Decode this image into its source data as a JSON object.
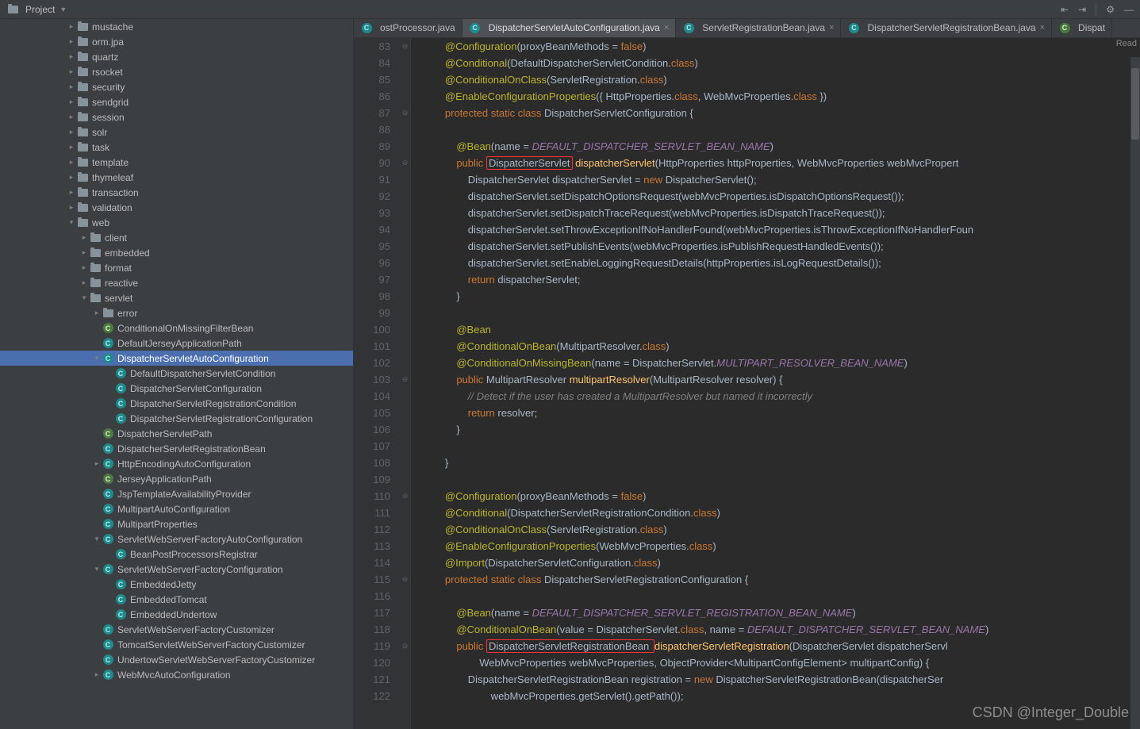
{
  "toolbar": {
    "project_label": "Project"
  },
  "read_indicator": "Read",
  "watermark": "CSDN @Integer_Double",
  "tabs": [
    {
      "label": "ostProcessor.java",
      "icon": "class-cyan",
      "active": false,
      "truncated": true
    },
    {
      "label": "DispatcherServletAutoConfiguration.java",
      "icon": "class-cyan",
      "active": true
    },
    {
      "label": "ServletRegistrationBean.java",
      "icon": "class-cyan",
      "active": false
    },
    {
      "label": "DispatcherServletRegistrationBean.java",
      "icon": "class-cyan",
      "active": false
    },
    {
      "label": "Dispat",
      "icon": "class-green",
      "active": false,
      "truncated": true
    }
  ],
  "tree": [
    {
      "indent": 5,
      "chev": ">",
      "icon": "folder",
      "label": "mustache"
    },
    {
      "indent": 5,
      "chev": ">",
      "icon": "folder",
      "label": "orm.jpa"
    },
    {
      "indent": 5,
      "chev": ">",
      "icon": "folder",
      "label": "quartz"
    },
    {
      "indent": 5,
      "chev": ">",
      "icon": "folder",
      "label": "rsocket"
    },
    {
      "indent": 5,
      "chev": ">",
      "icon": "folder",
      "label": "security"
    },
    {
      "indent": 5,
      "chev": ">",
      "icon": "folder",
      "label": "sendgrid"
    },
    {
      "indent": 5,
      "chev": ">",
      "icon": "folder",
      "label": "session"
    },
    {
      "indent": 5,
      "chev": ">",
      "icon": "folder",
      "label": "solr"
    },
    {
      "indent": 5,
      "chev": ">",
      "icon": "folder",
      "label": "task"
    },
    {
      "indent": 5,
      "chev": ">",
      "icon": "folder",
      "label": "template"
    },
    {
      "indent": 5,
      "chev": ">",
      "icon": "folder",
      "label": "thymeleaf"
    },
    {
      "indent": 5,
      "chev": ">",
      "icon": "folder",
      "label": "transaction"
    },
    {
      "indent": 5,
      "chev": ">",
      "icon": "folder",
      "label": "validation"
    },
    {
      "indent": 5,
      "chev": "v",
      "icon": "folder",
      "label": "web"
    },
    {
      "indent": 6,
      "chev": ">",
      "icon": "folder",
      "label": "client"
    },
    {
      "indent": 6,
      "chev": ">",
      "icon": "folder",
      "label": "embedded"
    },
    {
      "indent": 6,
      "chev": ">",
      "icon": "folder",
      "label": "format"
    },
    {
      "indent": 6,
      "chev": ">",
      "icon": "folder",
      "label": "reactive"
    },
    {
      "indent": 6,
      "chev": "v",
      "icon": "folder",
      "label": "servlet"
    },
    {
      "indent": 7,
      "chev": ">",
      "icon": "folder",
      "label": "error"
    },
    {
      "indent": 7,
      "chev": "",
      "icon": "class-green",
      "label": "ConditionalOnMissingFilterBean"
    },
    {
      "indent": 7,
      "chev": "",
      "icon": "class-cyan",
      "label": "DefaultJerseyApplicationPath"
    },
    {
      "indent": 7,
      "chev": "v",
      "icon": "class-cyan",
      "label": "DispatcherServletAutoConfiguration",
      "selected": true
    },
    {
      "indent": 8,
      "chev": "",
      "icon": "class-cyan",
      "label": "DefaultDispatcherServletCondition"
    },
    {
      "indent": 8,
      "chev": "",
      "icon": "class-cyan",
      "label": "DispatcherServletConfiguration"
    },
    {
      "indent": 8,
      "chev": "",
      "icon": "class-cyan",
      "label": "DispatcherServletRegistrationCondition"
    },
    {
      "indent": 8,
      "chev": "",
      "icon": "class-cyan",
      "label": "DispatcherServletRegistrationConfiguration"
    },
    {
      "indent": 7,
      "chev": "",
      "icon": "class-green",
      "label": "DispatcherServletPath"
    },
    {
      "indent": 7,
      "chev": "",
      "icon": "class-cyan",
      "label": "DispatcherServletRegistrationBean"
    },
    {
      "indent": 7,
      "chev": ">",
      "icon": "class-cyan",
      "label": "HttpEncodingAutoConfiguration"
    },
    {
      "indent": 7,
      "chev": "",
      "icon": "class-green",
      "label": "JerseyApplicationPath"
    },
    {
      "indent": 7,
      "chev": "",
      "icon": "class-cyan",
      "label": "JspTemplateAvailabilityProvider"
    },
    {
      "indent": 7,
      "chev": "",
      "icon": "class-cyan",
      "label": "MultipartAutoConfiguration"
    },
    {
      "indent": 7,
      "chev": "",
      "icon": "class-cyan",
      "label": "MultipartProperties"
    },
    {
      "indent": 7,
      "chev": "v",
      "icon": "class-cyan",
      "label": "ServletWebServerFactoryAutoConfiguration"
    },
    {
      "indent": 8,
      "chev": "",
      "icon": "class-cyan",
      "label": "BeanPostProcessorsRegistrar"
    },
    {
      "indent": 7,
      "chev": "v",
      "icon": "class-cyan",
      "label": "ServletWebServerFactoryConfiguration"
    },
    {
      "indent": 8,
      "chev": "",
      "icon": "class-cyan",
      "label": "EmbeddedJetty"
    },
    {
      "indent": 8,
      "chev": "",
      "icon": "class-cyan",
      "label": "EmbeddedTomcat"
    },
    {
      "indent": 8,
      "chev": "",
      "icon": "class-cyan",
      "label": "EmbeddedUndertow"
    },
    {
      "indent": 7,
      "chev": "",
      "icon": "class-cyan",
      "label": "ServletWebServerFactoryCustomizer"
    },
    {
      "indent": 7,
      "chev": "",
      "icon": "class-cyan",
      "label": "TomcatServletWebServerFactoryCustomizer"
    },
    {
      "indent": 7,
      "chev": "",
      "icon": "class-cyan",
      "label": "UndertowServletWebServerFactoryCustomizer"
    },
    {
      "indent": 7,
      "chev": ">",
      "icon": "class-cyan",
      "label": "WebMvcAutoConfiguration"
    }
  ],
  "code": {
    "first_line": 83,
    "lines": [
      {
        "n": 83,
        "h": "        <span class='an'>@Configuration</span>(proxyBeanMethods = <span class='k'>false</span>)"
      },
      {
        "n": 84,
        "h": "        <span class='an'>@Conditional</span>(DefaultDispatcherServletCondition.<span class='k'>class</span>)"
      },
      {
        "n": 85,
        "h": "        <span class='an'>@ConditionalOnClass</span>(ServletRegistration.<span class='k'>class</span>)"
      },
      {
        "n": 86,
        "h": "        <span class='an'>@EnableConfigurationProperties</span>({ HttpProperties.<span class='k'>class</span>, WebMvcProperties.<span class='k'>class</span> })"
      },
      {
        "n": 87,
        "h": "        <span class='k'>protected</span> <span class='k'>static</span> <span class='k'>class</span> DispatcherServletConfiguration {"
      },
      {
        "n": 88,
        "h": ""
      },
      {
        "n": 89,
        "h": "            <span class='an'>@Bean</span>(name = <span class='fld'>DEFAULT_DISPATCHER_SERVLET_BEAN_NAME</span>)"
      },
      {
        "n": 90,
        "h": "            <span class='k'>public</span> <span class='box-red'>DispatcherServlet</span> <span class='fn'>dispatcherServlet</span>(HttpProperties httpProperties, WebMvcProperties webMvcPropert"
      },
      {
        "n": 91,
        "h": "                DispatcherServlet dispatcherServlet = <span class='k'>new</span> DispatcherServlet();"
      },
      {
        "n": 92,
        "h": "                dispatcherServlet.setDispatchOptionsRequest(webMvcProperties.isDispatchOptionsRequest());"
      },
      {
        "n": 93,
        "h": "                dispatcherServlet.setDispatchTraceRequest(webMvcProperties.isDispatchTraceRequest());"
      },
      {
        "n": 94,
        "h": "                dispatcherServlet.setThrowExceptionIfNoHandlerFound(webMvcProperties.isThrowExceptionIfNoHandlerFoun"
      },
      {
        "n": 95,
        "h": "                dispatcherServlet.setPublishEvents(webMvcProperties.isPublishRequestHandledEvents());"
      },
      {
        "n": 96,
        "h": "                dispatcherServlet.setEnableLoggingRequestDetails(httpProperties.isLogRequestDetails());"
      },
      {
        "n": 97,
        "h": "                <span class='k'>return</span> dispatcherServlet;"
      },
      {
        "n": 98,
        "h": "            }"
      },
      {
        "n": 99,
        "h": ""
      },
      {
        "n": 100,
        "h": "            <span class='an'>@Bean</span>"
      },
      {
        "n": 101,
        "h": "            <span class='an'>@ConditionalOnBean</span>(MultipartResolver.<span class='k'>class</span>)"
      },
      {
        "n": 102,
        "h": "            <span class='an'>@ConditionalOnMissingBean</span>(name = DispatcherServlet.<span class='fld'>MULTIPART_RESOLVER_BEAN_NAME</span>)"
      },
      {
        "n": 103,
        "h": "            <span class='k'>public</span> MultipartResolver <span class='fn'>multipartResolver</span>(MultipartResolver resolver) {"
      },
      {
        "n": 104,
        "h": "                <span class='cmt'>// Detect if the user has created a MultipartResolver but named it incorrectly</span>"
      },
      {
        "n": 105,
        "h": "                <span class='k'>return</span> resolver;"
      },
      {
        "n": 106,
        "h": "            }"
      },
      {
        "n": 107,
        "h": ""
      },
      {
        "n": 108,
        "h": "        }"
      },
      {
        "n": 109,
        "h": ""
      },
      {
        "n": 110,
        "h": "        <span class='an'>@Configuration</span>(proxyBeanMethods = <span class='k'>false</span>)"
      },
      {
        "n": 111,
        "h": "        <span class='an'>@Conditional</span>(DispatcherServletRegistrationCondition.<span class='k'>class</span>)"
      },
      {
        "n": 112,
        "h": "        <span class='an'>@ConditionalOnClass</span>(ServletRegistration.<span class='k'>class</span>)"
      },
      {
        "n": 113,
        "h": "        <span class='an'>@EnableConfigurationProperties</span>(WebMvcProperties.<span class='k'>class</span>)"
      },
      {
        "n": 114,
        "h": "        <span class='an'>@Import</span>(DispatcherServletConfiguration.<span class='k'>class</span>)"
      },
      {
        "n": 115,
        "h": "        <span class='k'>protected</span> <span class='k'>static</span> <span class='k'>class</span> DispatcherServletRegistrationConfiguration {"
      },
      {
        "n": 116,
        "h": ""
      },
      {
        "n": 117,
        "h": "            <span class='an'>@Bean</span>(name = <span class='fld'>DEFAULT_DISPATCHER_SERVLET_REGISTRATION_BEAN_NAME</span>)"
      },
      {
        "n": 118,
        "h": "            <span class='an'>@ConditionalOnBean</span>(value = DispatcherServlet.<span class='k'>class</span>, name = <span class='fld'>DEFAULT_DISPATCHER_SERVLET_BEAN_NAME</span>)"
      },
      {
        "n": 119,
        "h": "            <span class='k'>public</span> <span class='box-red'>DispatcherServletRegistrationBean </span><span class='fn'>dispatcherServletRegistration</span>(DispatcherServlet dispatcherServl"
      },
      {
        "n": 120,
        "h": "                    WebMvcProperties webMvcProperties, ObjectProvider&lt;MultipartConfigElement&gt; multipartConfig) {"
      },
      {
        "n": 121,
        "h": "                DispatcherServletRegistrationBean registration = <span class='k'>new</span> DispatcherServletRegistrationBean(dispatcherSer"
      },
      {
        "n": 122,
        "h": "                        webMvcProperties.getServlet().getPath());"
      }
    ]
  }
}
